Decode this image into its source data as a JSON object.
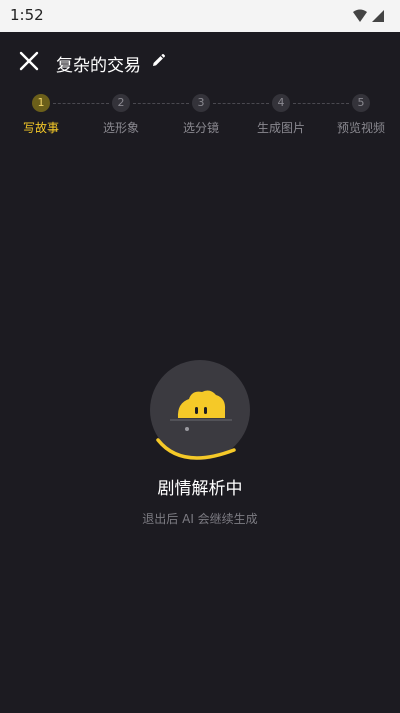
{
  "status_bar": {
    "time": "1:52"
  },
  "header": {
    "title": "复杂的交易"
  },
  "steps": [
    {
      "number": "1",
      "label": "写故事",
      "active": true
    },
    {
      "number": "2",
      "label": "选形象",
      "active": false
    },
    {
      "number": "3",
      "label": "选分镜",
      "active": false
    },
    {
      "number": "4",
      "label": "生成图片",
      "active": false
    },
    {
      "number": "5",
      "label": "预览视频",
      "active": false
    }
  ],
  "loading": {
    "title": "剧情解析中",
    "subtitle": "退出后 AI 会继续生成"
  },
  "colors": {
    "accent": "#f5c928",
    "background": "#1c1b21"
  }
}
